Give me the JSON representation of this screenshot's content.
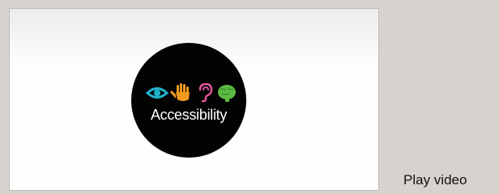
{
  "thumbnail": {
    "badge_text": "Accessibility",
    "icons": [
      "eye-icon",
      "hand-icon",
      "ear-icon",
      "brain-icon"
    ],
    "colors": {
      "badge": "#030303",
      "eye": "#1fb3c9",
      "hand": "#f29a1c",
      "ear": "#e0569c",
      "brain": "#5dbb44"
    }
  },
  "play_link": {
    "label": "Play video"
  }
}
